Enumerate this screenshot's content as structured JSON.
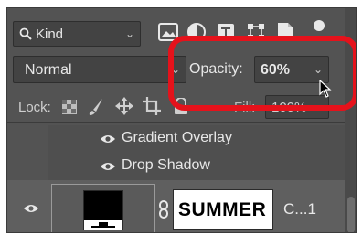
{
  "filter": {
    "label": "Kind"
  },
  "blend": {
    "mode": "Normal"
  },
  "opacity": {
    "label": "Opacity:",
    "value": "60%"
  },
  "lock": {
    "label": "Lock:"
  },
  "fill": {
    "label": "Fill:",
    "value": "100%"
  },
  "effects": [
    {
      "label": "Gradient Overlay"
    },
    {
      "label": "Drop Shadow"
    }
  ],
  "layer": {
    "mask_text": "SUMMER",
    "name": "C...1"
  },
  "colors": {
    "highlight": "#e5121b",
    "panel": "#535353"
  }
}
